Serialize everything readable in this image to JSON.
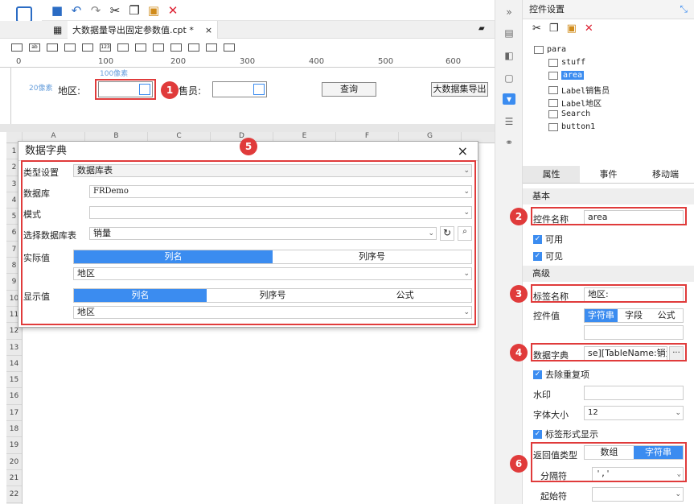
{
  "toolbar": {
    "icons": [
      "app-menu-icon",
      "save-icon",
      "undo-icon",
      "redo-icon",
      "cut-icon",
      "copy-icon",
      "paste-icon",
      "delete-icon"
    ]
  },
  "tab": {
    "label": "大数据量导出固定参数值.cpt *",
    "close": "×"
  },
  "ruler": {
    "ticks": [
      "0",
      "100",
      "200",
      "300",
      "400",
      "500",
      "600"
    ],
    "hint_x": "100像素",
    "hint_y": "20像素"
  },
  "canvas": {
    "area_label": "地区:",
    "salesman_label": "售员:",
    "query_button": "查询",
    "export_button": "大数据集导出"
  },
  "sheet": {
    "columns": [
      "A",
      "B",
      "C",
      "D",
      "E",
      "F",
      "G"
    ],
    "rows": [
      "1",
      "2",
      "3",
      "4",
      "5",
      "6",
      "7",
      "8",
      "9",
      "10",
      "11",
      "12",
      "13",
      "14",
      "15",
      "16",
      "17",
      "18",
      "19",
      "20",
      "21",
      "22"
    ]
  },
  "dialog": {
    "title": "数据字典",
    "close": "×",
    "type_label": "类型设置",
    "type_value": "数据库表",
    "db_label": "数据库",
    "db_value": "FRDemo",
    "schema_label": "模式",
    "schema_value": "",
    "table_label": "选择数据库表",
    "table_value": "销量",
    "actual_label": "实际值",
    "actual_tabs": [
      "列名",
      "列序号"
    ],
    "actual_value": "地区",
    "display_label": "显示值",
    "display_tabs": [
      "列名",
      "列序号",
      "公式"
    ],
    "display_value": "地区"
  },
  "badges": [
    "1",
    "2",
    "3",
    "4",
    "5",
    "6"
  ],
  "panel": {
    "title": "控件设置",
    "tree": [
      "para",
      "stuff",
      "area",
      "Label销售员",
      "Label地区",
      "Search",
      "button1"
    ],
    "tabs": [
      "属性",
      "事件",
      "移动端"
    ],
    "basic": "基本",
    "ctrl_name_label": "控件名称",
    "ctrl_name": "area",
    "enabled": "可用",
    "visible": "可见",
    "advanced": "高级",
    "label_name_label": "标签名称",
    "label_name": "地区:",
    "ctrl_value_label": "控件值",
    "ctrl_value_tabs": [
      "字符串",
      "字段",
      "公式"
    ],
    "dict_label": "数据字典",
    "dict_value": "se][TableName:销量]",
    "dict_more": "···",
    "dedupe": "去除重复项",
    "watermark_label": "水印",
    "fontsize_label": "字体大小",
    "fontsize": "12",
    "label_form": "标签形式显示",
    "return_label": "返回值类型",
    "return_tabs": [
      "数组",
      "字符串"
    ],
    "sep_label": "分隔符",
    "sep_value": "','",
    "start_label": "起始符"
  },
  "colors": {
    "accent": "#3b8cf0",
    "highlight": "#e03b3b"
  }
}
